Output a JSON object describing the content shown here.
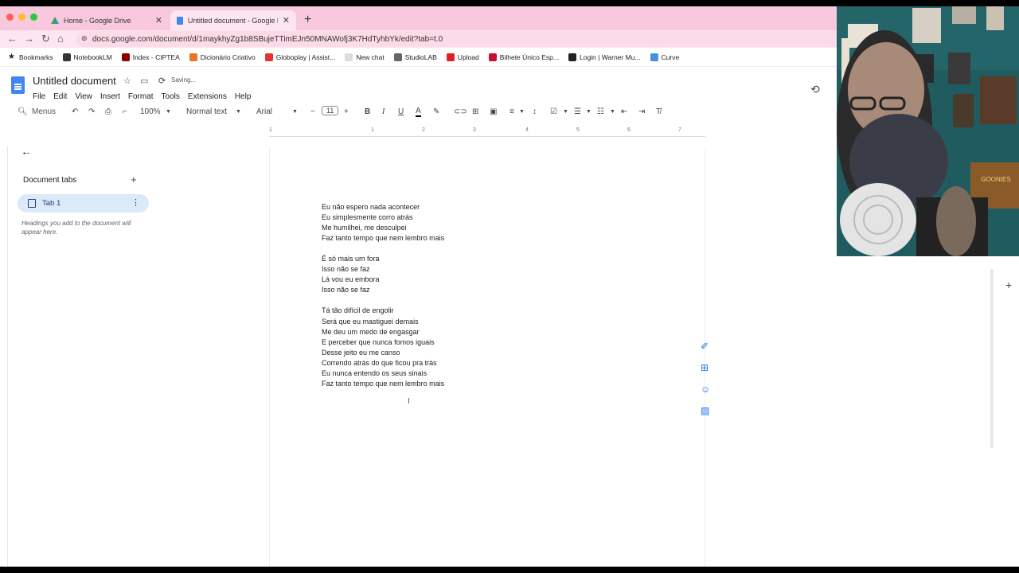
{
  "browser": {
    "tabs": [
      {
        "title": "Home - Google Drive",
        "active": false
      },
      {
        "title": "Untitled document - Google D",
        "active": true
      }
    ],
    "url": "docs.google.com/document/d/1maykhyZg1b8SBujeTTimEJn50MNAWofj3K7HdTyhbYk/edit?tab=t.0"
  },
  "bookmarks": [
    {
      "label": "Bookmarks",
      "icon": "star-icon",
      "color": "#222222"
    },
    {
      "label": "NotebookLM",
      "icon": "notebooklm-icon",
      "color": "#333333"
    },
    {
      "label": "Index - CIPTEA",
      "icon": "ciptea-icon",
      "color": "#8b0000"
    },
    {
      "label": "Dicionário Criativo",
      "icon": "dictionary-icon",
      "color": "#e8742a"
    },
    {
      "label": "Globoplay | Assist...",
      "icon": "globoplay-icon",
      "color": "#e3342f"
    },
    {
      "label": "New chat",
      "icon": "chat-icon",
      "color": "#dddddd"
    },
    {
      "label": "StudioLAB",
      "icon": "studiolab-icon",
      "color": "#666666"
    },
    {
      "label": "Upload",
      "icon": "upload-icon",
      "color": "#e02020"
    },
    {
      "label": "Bilhete Único Esp...",
      "icon": "bilhete-icon",
      "color": "#c8102e"
    },
    {
      "label": "Login | Warner Mu...",
      "icon": "warner-icon",
      "color": "#222222"
    },
    {
      "label": "Curve",
      "icon": "curve-icon",
      "color": "#4a90d9"
    }
  ],
  "docs": {
    "title": "Untitled document",
    "status": "Saving...",
    "menus": [
      "File",
      "Edit",
      "View",
      "Insert",
      "Format",
      "Tools",
      "Extensions",
      "Help"
    ]
  },
  "format_toolbar": {
    "search": "Menus",
    "zoom": "100%",
    "style": "Normal text",
    "font": "Arial",
    "font_size": "11"
  },
  "ruler_numbers": [
    "1",
    "1",
    "2",
    "3",
    "4",
    "5",
    "6",
    "7"
  ],
  "sidebar": {
    "section_title": "Document tabs",
    "tab_label": "Tab 1",
    "hint": "Headings you add to the document will appear here."
  },
  "document": {
    "lines": [
      "Eu não espero nada acontecer",
      "Eu simplesmente corro atrás",
      "Me humilhei, me desculpei",
      "Faz tanto tempo que nem lembro mais",
      "",
      "É só mais um fora",
      "Isso não se faz",
      "Lá vou eu embora",
      "Isso não se faz",
      "",
      "Tá tão difícil de engolir",
      "Será que eu mastiguei demais",
      "Me deu um medo de engasgar",
      "E perceber que nunca fomos iguais",
      "Desse jeito eu me canso",
      "Correndo atrás do que ficou pra trás",
      "Eu nunca entendo os seus sinais",
      "Faz tanto tempo que nem lembro mais"
    ]
  },
  "colors": {
    "tabstrip": "#f8c8dc",
    "accent": "#1a73e8",
    "tab_highlight": "#dce9f8"
  }
}
